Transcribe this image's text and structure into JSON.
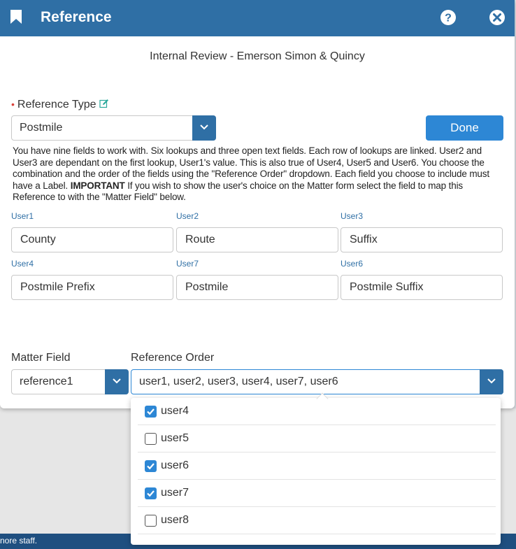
{
  "modal": {
    "title": "Reference",
    "subtitle": "Internal Review - Emerson Simon & Quincy"
  },
  "reference_type": {
    "label": "Reference Type",
    "value": "Postmile"
  },
  "done_label": "Done",
  "info": {
    "part1": "You have nine fields to work with. Six lookups and three open text fields. Each row of lookups are linked. User2 and User3 are dependant on the first lookup, User1's value. This is also true of User4, User5 and User6. You choose the combination and the order of the fields using the \"Reference Order\" dropdown. Each field you choose to include must have a Label. ",
    "important": "IMPORTANT",
    "part2": " If you wish to show the user's choice on the Matter form select the field to map this Reference to with the \"Matter Field\" below."
  },
  "fields": [
    {
      "label": "User1",
      "value": "County"
    },
    {
      "label": "User2",
      "value": "Route"
    },
    {
      "label": "User3",
      "value": "Suffix"
    },
    {
      "label": "User4",
      "value": "Postmile Prefix"
    },
    {
      "label": "User7",
      "value": "Postmile"
    },
    {
      "label": "User6",
      "value": "Postmile Suffix"
    }
  ],
  "matter_field": {
    "label": "Matter Field",
    "value": "reference1"
  },
  "reference_order": {
    "label": "Reference Order",
    "value": "user1, user2, user3, user4, user7, user6",
    "options": [
      {
        "label": "user4",
        "checked": true
      },
      {
        "label": "user5",
        "checked": false
      },
      {
        "label": "user6",
        "checked": true
      },
      {
        "label": "user7",
        "checked": true
      },
      {
        "label": "user8",
        "checked": false
      }
    ]
  },
  "footer_text": "nore staff.",
  "colors": {
    "header": "#2f6fa5",
    "button": "#2d87d5",
    "required": "#d9423a",
    "footer": "#1f4f80"
  },
  "icons": [
    "bookmark-icon",
    "help-icon",
    "close-icon",
    "edit-icon",
    "chevron-down-icon",
    "checkbox-icon"
  ]
}
